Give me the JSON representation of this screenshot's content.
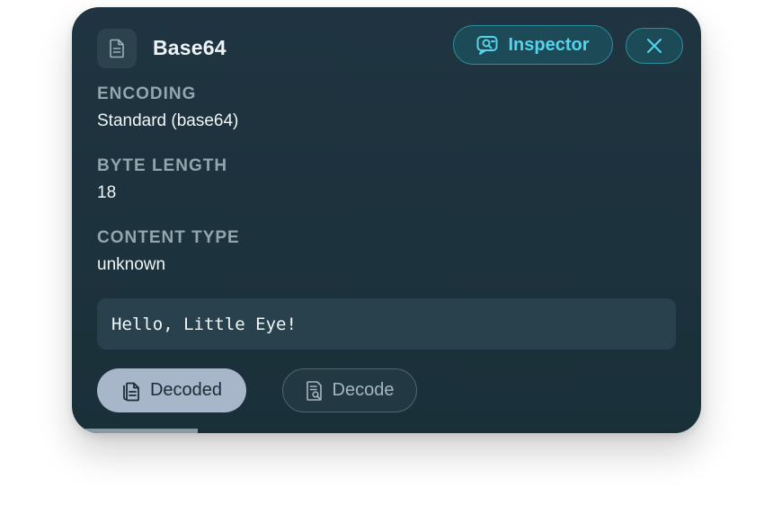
{
  "header": {
    "title": "Base64",
    "inspector_label": "Inspector",
    "icon": "document-icon",
    "close_icon": "close-icon"
  },
  "fields": {
    "encoding": {
      "label": "ENCODING",
      "value": "Standard (base64)"
    },
    "byte_length": {
      "label": "BYTE LENGTH",
      "value": "18"
    },
    "content_type": {
      "label": "CONTENT TYPE",
      "value": "unknown"
    }
  },
  "decoded_output": "Hello, Little Eye!",
  "actions": {
    "decoded_label": "Decoded",
    "decode_label": "Decode",
    "decoded_icon": "copy-document-icon",
    "decode_icon": "document-search-icon"
  },
  "progress": 0.2,
  "colors": {
    "accent": "#56d3ea",
    "card_background": "#1f3440",
    "active_pill": "#a7b6c8"
  }
}
